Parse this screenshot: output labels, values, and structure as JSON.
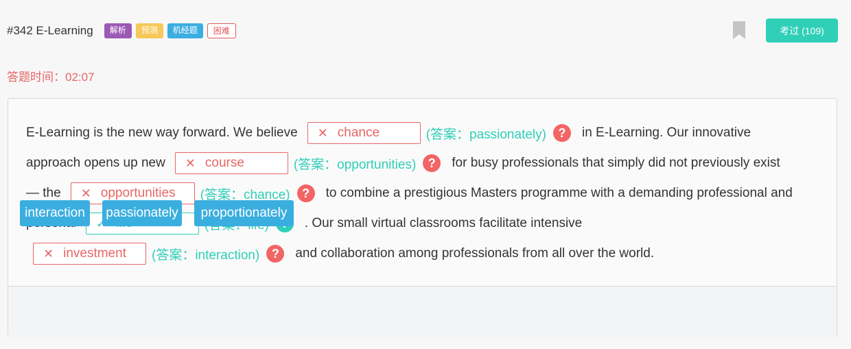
{
  "header": {
    "title": "#342 E-Learning",
    "tags": [
      "解析",
      "预测",
      "机经题",
      "困难"
    ],
    "passed_label": "考过 (109)"
  },
  "timer": {
    "label": "答题时间：",
    "value": "02:07"
  },
  "passage": {
    "line1": {
      "pre": "E-Learning is the new way forward. We believe",
      "blank_mark": "✕",
      "blank": "chance",
      "answer": "(答案：passionately)",
      "help": "?",
      "post": "in E-Learning. Our innovative"
    },
    "line2": {
      "pre": "approach opens up new",
      "blank_mark": "✕",
      "blank": "course",
      "answer": "(答案：opportunities)",
      "help": "?",
      "post": "for busy professionals that simply did not previously exist"
    },
    "line3": {
      "pre": "— the",
      "blank_mark": "✕",
      "blank": "opportunities",
      "answer": "(答案：chance)",
      "help": "?",
      "post": "to combine a prestigious Masters programme with a demanding professional and"
    },
    "line4": {
      "pre": "personal",
      "blank_mark": "✓",
      "blank": "life",
      "answer": "(答案：life)",
      "help": "?",
      "post": ". Our small virtual classrooms facilitate intensive"
    },
    "line5": {
      "blank_mark": "✕",
      "blank": "investment",
      "answer": "(答案：interaction)",
      "help": "?",
      "post": "and collaboration among professionals from all over the world."
    }
  },
  "options": [
    "interaction",
    "passionately",
    "proportionately"
  ],
  "colors": {
    "accent": "#2fcfb8",
    "wrong": "#e86565",
    "chip": "#3baee0"
  },
  "icons": {
    "bookmark": "bookmark-icon",
    "wrong": "x-icon",
    "right": "check-icon",
    "help": "question-icon"
  }
}
